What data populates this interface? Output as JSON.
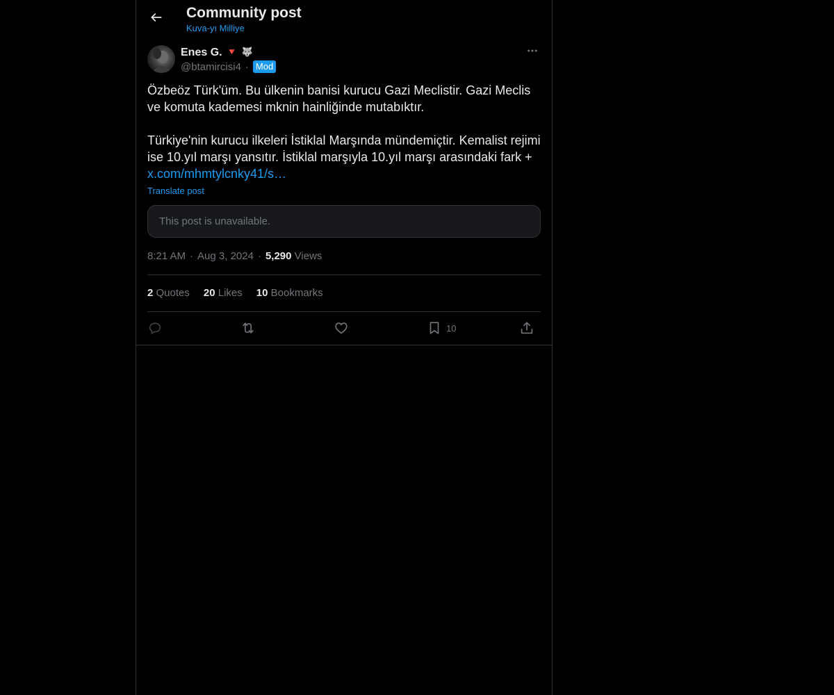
{
  "header": {
    "title": "Community post",
    "community": "Kuva-yı Milliye",
    "back_icon": "arrow-left-icon"
  },
  "author": {
    "name": "Enes G.",
    "emoji_1": "🔻",
    "emoji_2": "🐺",
    "handle": "@btamircisi4",
    "separator": "·",
    "badge": "Mod",
    "more_icon": "more-horizontal-icon"
  },
  "post": {
    "paragraph_1": "Özbeöz Türk'üm. Bu ülkenin banisi kurucu Gazi Meclistir. Gazi Meclis ve komuta kademesi mknin hainliğinde mutabıktır.",
    "paragraph_2_text": "Türkiye'nin kurucu ilkeleri İstiklal Marşında mündemiçtir. Kemalist rejimi ise 10.yıl marşı yansıtır. İstiklal marşıyla 10.yıl marşı arasındaki fark + ",
    "paragraph_2_link": "x.com/mhmtylcnky41/s…",
    "translate_label": "Translate post",
    "quoted_unavailable": "This post is unavailable."
  },
  "meta": {
    "time": "8:21 AM",
    "date": "Aug 3, 2024",
    "views_count": "5,290",
    "views_label": "Views",
    "dot": "·"
  },
  "stats": {
    "quotes_count": "2",
    "quotes_label": "Quotes",
    "likes_count": "20",
    "likes_label": "Likes",
    "bookmarks_count": "10",
    "bookmarks_label": "Bookmarks"
  },
  "actions": {
    "reply_icon": "reply-icon",
    "retweet_icon": "retweet-icon",
    "like_icon": "heart-icon",
    "bookmark_icon": "bookmark-icon",
    "bookmark_count": "10",
    "share_icon": "share-icon"
  },
  "colors": {
    "background": "#000000",
    "text_primary": "#e7e9ea",
    "text_secondary": "#71767b",
    "accent": "#1d9bf0",
    "border": "#2f3336",
    "reply_disabled": "#3e4144"
  }
}
